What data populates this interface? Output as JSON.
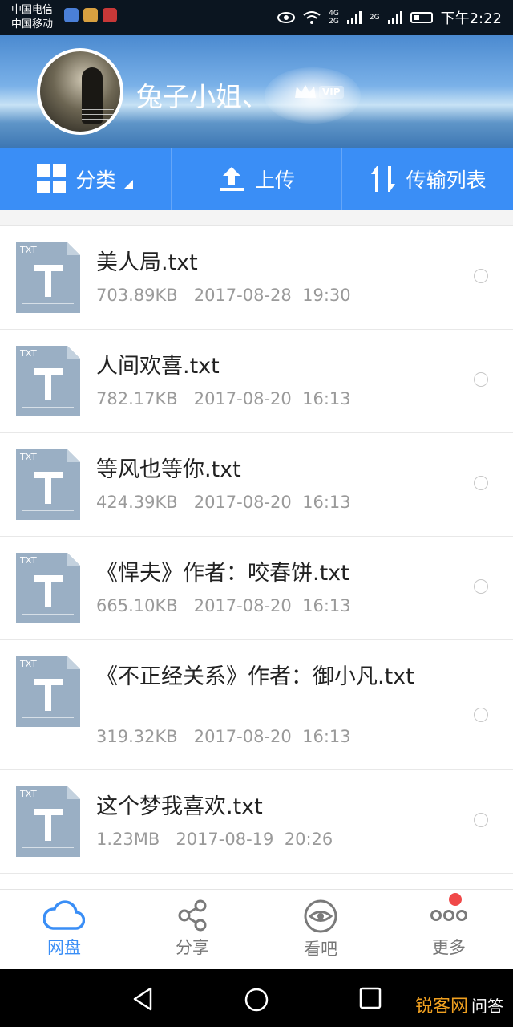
{
  "status_bar": {
    "carrier1": "中国电信",
    "carrier2": "中国移动",
    "network_label_1": "4G",
    "network_label_2": "2G",
    "network_label_3": "2G",
    "time": "下午2:22"
  },
  "header": {
    "username": "兔子小姐、",
    "vip_label": "VIP"
  },
  "toolbar": {
    "category_label": "分类",
    "upload_label": "上传",
    "transfer_label": "传输列表"
  },
  "files": [
    {
      "name": "美人局.txt",
      "size": "703.89KB",
      "date": "2017-08-28",
      "time": "19:30",
      "type_label": "TXT"
    },
    {
      "name": "人间欢喜.txt",
      "size": "782.17KB",
      "date": "2017-08-20",
      "time": "16:13",
      "type_label": "TXT"
    },
    {
      "name": "等风也等你.txt",
      "size": "424.39KB",
      "date": "2017-08-20",
      "time": "16:13",
      "type_label": "TXT"
    },
    {
      "name": "《悍夫》作者：咬春饼.txt",
      "size": "665.10KB",
      "date": "2017-08-20",
      "time": "16:13",
      "type_label": "TXT"
    },
    {
      "name": "《不正经关系》作者：御小凡.txt",
      "size": "319.32KB",
      "date": "2017-08-20",
      "time": "16:13",
      "type_label": "TXT"
    },
    {
      "name": "这个梦我喜欢.txt",
      "size": "1.23MB",
      "date": "2017-08-19",
      "time": "20:26",
      "type_label": "TXT"
    }
  ],
  "bottom_nav": {
    "items": [
      {
        "label": "网盘",
        "icon": "cloud-icon",
        "active": true
      },
      {
        "label": "分享",
        "icon": "share-icon",
        "active": false
      },
      {
        "label": "看吧",
        "icon": "eye-icon",
        "active": false
      },
      {
        "label": "更多",
        "icon": "more-icon",
        "active": false,
        "badge": true
      }
    ]
  },
  "watermark": {
    "text_a": "锐客网",
    "text_b": "问答"
  },
  "colors": {
    "accent": "#3a8ef6",
    "badge": "#f04848",
    "file_icon": "#9aafc4"
  }
}
